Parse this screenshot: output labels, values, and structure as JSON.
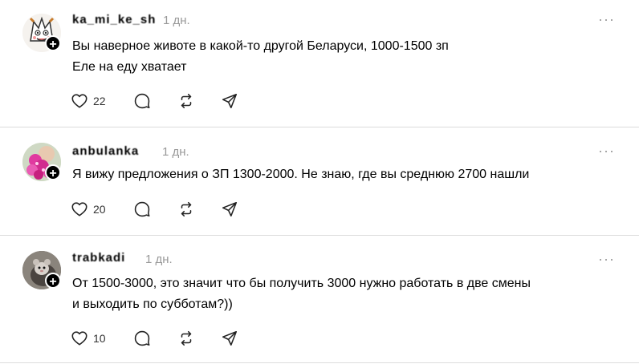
{
  "posts": [
    {
      "username": "ka_mi_ke_sh",
      "time": "1 дн.",
      "lines": [
        "Вы наверное животе в какой-то другой Беларуси, 1000-1500 зп",
        "Еле на еду хватает"
      ],
      "likes": "22",
      "avatar": "cartoon"
    },
    {
      "username": "anbulanka",
      "time": "1 дн.",
      "lines": [
        "Я вижу предложения о ЗП 1300-2000. Не знаю, где вы среднюю 2700 нашли"
      ],
      "likes": "20",
      "avatar": "flowers"
    },
    {
      "username": "trabkadi",
      "time": "1 дн.",
      "lines": [
        "От 1500-3000, это значит что бы получить 3000 нужно работать в две смены",
        "и выходить по субботам?))"
      ],
      "likes": "10",
      "avatar": "animal"
    }
  ],
  "icons": {
    "more": "more-dots-icon",
    "follow": "plus-icon",
    "like": "heart-icon",
    "reply": "comment-icon",
    "repost": "repost-icon",
    "share": "send-icon"
  },
  "more_glyph": "···",
  "plus_glyph": "+"
}
